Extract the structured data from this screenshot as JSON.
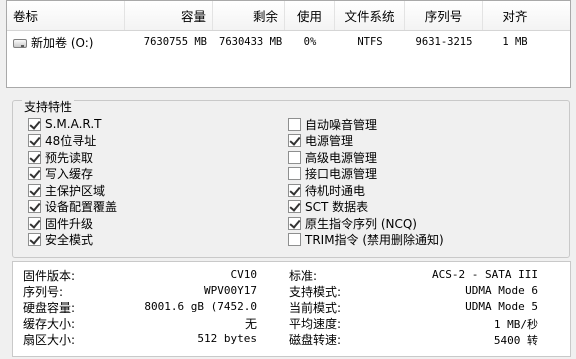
{
  "volumes": {
    "columns": [
      "卷标",
      "容量",
      "剩余",
      "使用",
      "文件系统",
      "序列号",
      "对齐"
    ],
    "rows": [
      {
        "label": "新加卷 (O:)",
        "capacity": "7630755 MB",
        "free": "7630433 MB",
        "used": "0%",
        "fs": "NTFS",
        "serial": "9631-3215",
        "align": "1 MB"
      }
    ]
  },
  "features": {
    "title": "支持特性",
    "left": [
      {
        "label": "S.M.A.R.T",
        "checked": true
      },
      {
        "label": "48位寻址",
        "checked": true
      },
      {
        "label": "预先读取",
        "checked": true
      },
      {
        "label": "写入缓存",
        "checked": true
      },
      {
        "label": "主保护区域",
        "checked": true
      },
      {
        "label": "设备配置覆盖",
        "checked": true
      },
      {
        "label": "固件升级",
        "checked": true
      },
      {
        "label": "安全模式",
        "checked": true
      }
    ],
    "right": [
      {
        "label": "自动噪音管理",
        "checked": false
      },
      {
        "label": "电源管理",
        "checked": true
      },
      {
        "label": "高级电源管理",
        "checked": false
      },
      {
        "label": "接口电源管理",
        "checked": false
      },
      {
        "label": "待机时通电",
        "checked": true
      },
      {
        "label": "SCT 数据表",
        "checked": true
      },
      {
        "label": "原生指令序列 (NCQ)",
        "checked": true
      },
      {
        "label": "TRIM指令 (禁用删除通知)",
        "checked": false
      }
    ]
  },
  "info": {
    "left": [
      {
        "key": "固件版本:",
        "value": "CV10"
      },
      {
        "key": "序列号:",
        "value": "WPV00Y17"
      },
      {
        "key": "硬盘容量:",
        "value": "8001.6 gB (7452.0"
      },
      {
        "key": "缓存大小:",
        "value": "无"
      },
      {
        "key": "扇区大小:",
        "value": "512 bytes"
      }
    ],
    "right": [
      {
        "key": "标准:",
        "value": "ACS-2 - SATA III"
      },
      {
        "key": "支持模式:",
        "value": "UDMA Mode 6"
      },
      {
        "key": "当前模式:",
        "value": "UDMA Mode 5"
      },
      {
        "key": "平均速度:",
        "value": "1 MB/秒"
      },
      {
        "key": "磁盘转速:",
        "value": "5400 转"
      }
    ]
  }
}
